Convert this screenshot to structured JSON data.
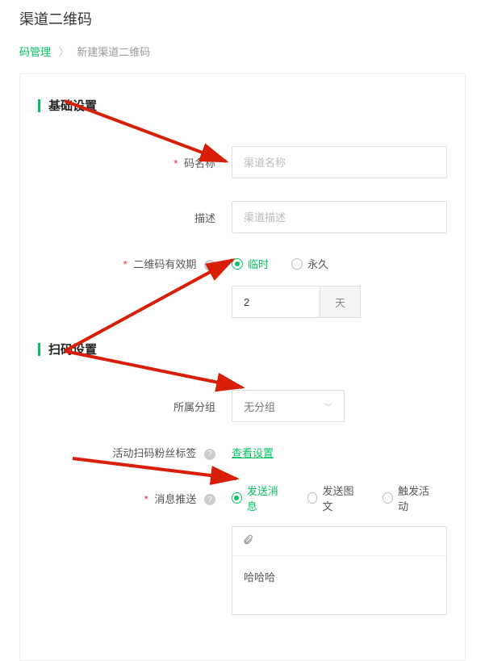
{
  "page_title": "渠道二维码",
  "breadcrumb": {
    "root": "码管理",
    "current": "新建渠道二维码",
    "sep": "〉"
  },
  "sections": {
    "basic": "基础设置",
    "scan": "扫码设置"
  },
  "labels": {
    "code_name": "码名称",
    "desc": "描述",
    "validity": "二维码有效期",
    "group": "所属分组",
    "tag": "活动扫码粉丝标签",
    "push": "消息推送"
  },
  "placeholders": {
    "code_name": "渠道名称",
    "desc": "渠道描述"
  },
  "validity": {
    "option_temp": "临时",
    "option_perm": "永久",
    "value": "2",
    "unit": "天"
  },
  "group": {
    "selected": "无分组"
  },
  "tag_link": "查看设置",
  "push": {
    "option_send": "发送消息",
    "option_image": "发送图文",
    "option_trigger": "触发活动",
    "content": "哈哈哈"
  }
}
